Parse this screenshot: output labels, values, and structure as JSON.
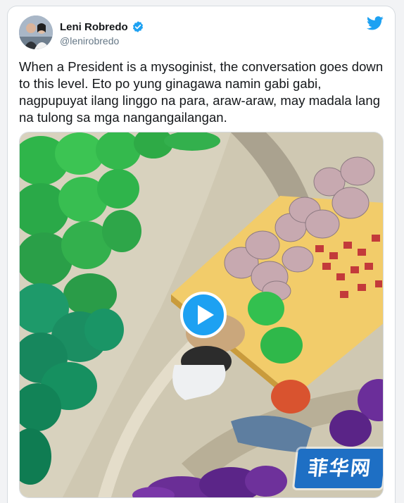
{
  "tweet": {
    "author_name": "Leni Robredo",
    "handle": "@lenirobredo",
    "verified": true,
    "text": "When a President is a mysoginist, the conversation goes down to this level. Eto po yung ginagawa namin gabi gabi, nagpupuyat ilang linggo na para, araw-araw, may madala lang na tulong sa mga nangangailangan."
  },
  "media": {
    "type": "video",
    "play_icon": "play-icon",
    "watermark_text": "菲华网"
  },
  "icons": {
    "brand": "twitter-bird-icon",
    "verified": "verified-badge-icon"
  },
  "colors": {
    "twitter_blue": "#1da1f2",
    "text_primary": "#14171a",
    "text_secondary": "#657786",
    "watermark_blue": "#1e6fc4"
  }
}
